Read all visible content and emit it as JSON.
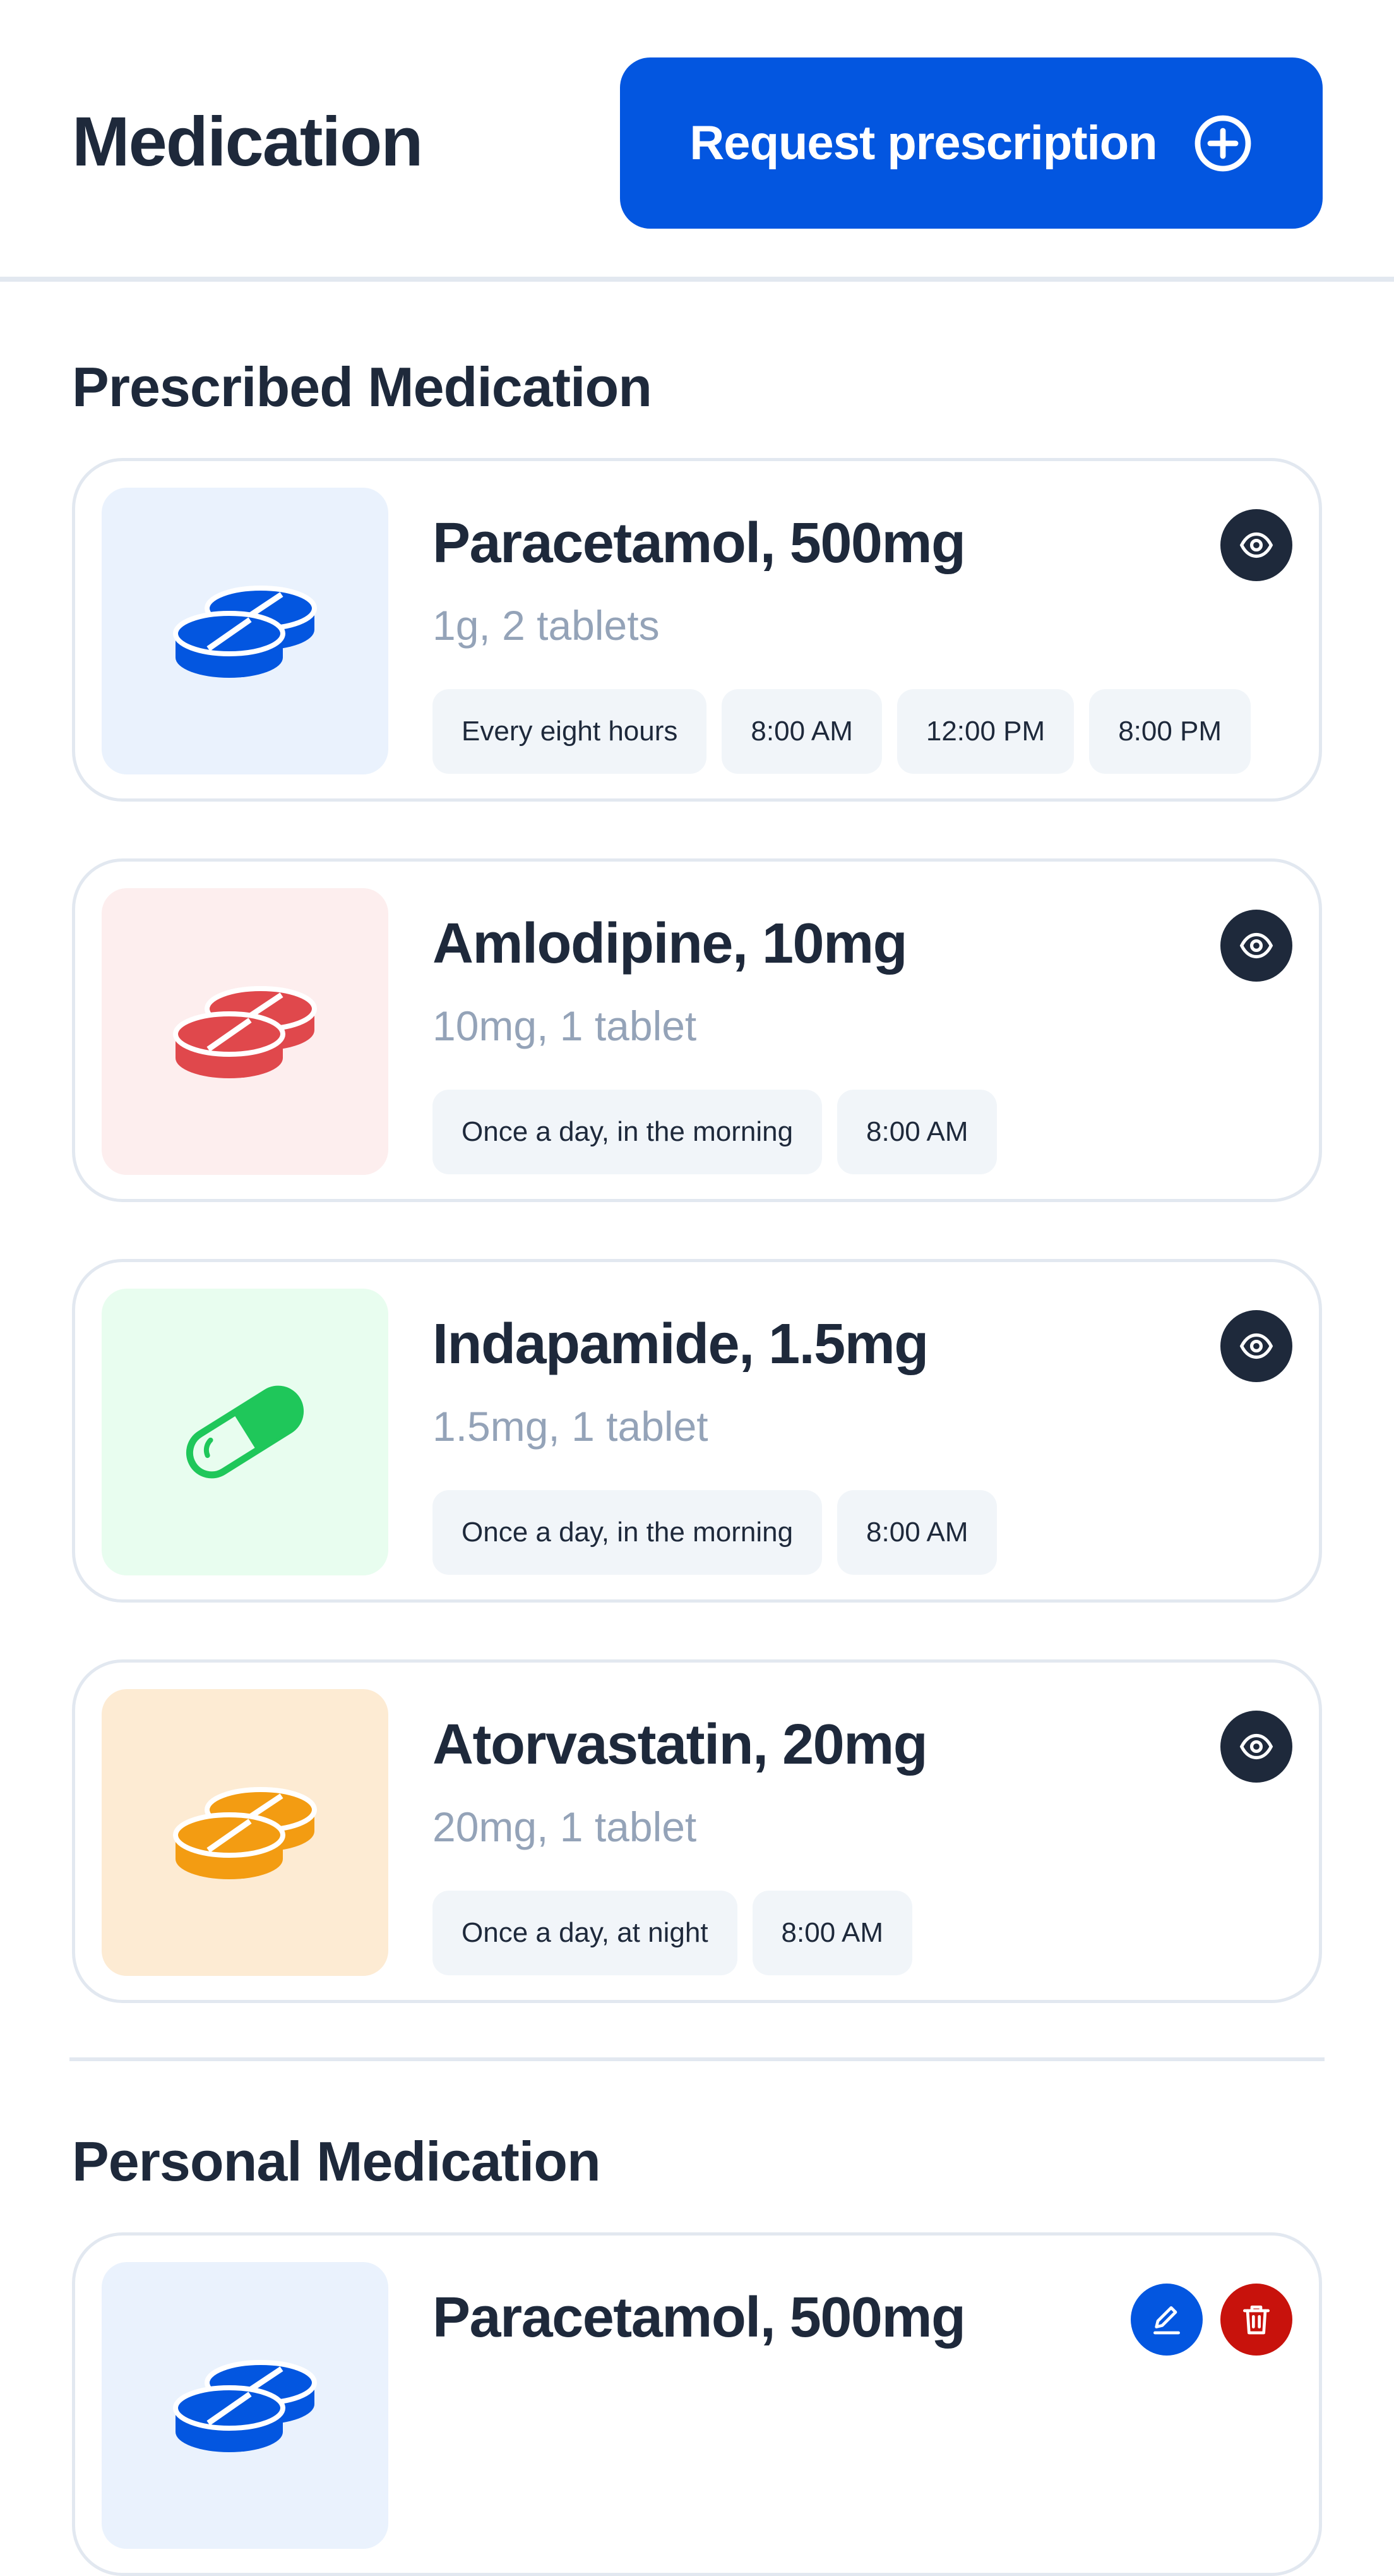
{
  "header": {
    "title": "Medication",
    "request_button": {
      "label": "Request prescription",
      "icon": "plus-circle-icon"
    }
  },
  "prescribed": {
    "title": "Prescribed Medication",
    "items": [
      {
        "name": "Paracetamol, 500mg",
        "dose": "1g, 2 tablets",
        "schedule": [
          "Every eight hours",
          "8:00 AM",
          "12:00 PM",
          "8:00 PM"
        ],
        "icon": "tablets-icon",
        "color": "#0356e0",
        "bg": "#eaf2fd"
      },
      {
        "name": "Amlodipine, 10mg",
        "dose": "10mg, 1 tablet",
        "schedule": [
          "Once a day, in the morning",
          "8:00 AM"
        ],
        "icon": "tablets-icon",
        "color": "#e0484c",
        "bg": "#fdeeee"
      },
      {
        "name": "Indapamide, 1.5mg",
        "dose": "1.5mg, 1 tablet",
        "schedule": [
          "Once a day, in the morning",
          "8:00 AM"
        ],
        "icon": "capsule-icon",
        "color": "#1fc75a",
        "bg": "#e8fdef"
      },
      {
        "name": "Atorvastatin, 20mg",
        "dose": "20mg, 1 tablet",
        "schedule": [
          "Once a day, at night",
          "8:00 AM"
        ],
        "icon": "tablets-icon",
        "color": "#f39c12",
        "bg": "#fdebd3"
      }
    ]
  },
  "personal": {
    "title": "Personal Medication",
    "items": [
      {
        "name": "Paracetamol, 500mg",
        "icon": "tablets-icon",
        "bg": "#eaf2fd"
      }
    ]
  },
  "colors": {
    "primary": "#0356e0",
    "dark": "#1e293b",
    "muted": "#94a3b8",
    "border": "#e2e8f0",
    "chip": "#f1f5f9",
    "danger": "#c8120c"
  }
}
